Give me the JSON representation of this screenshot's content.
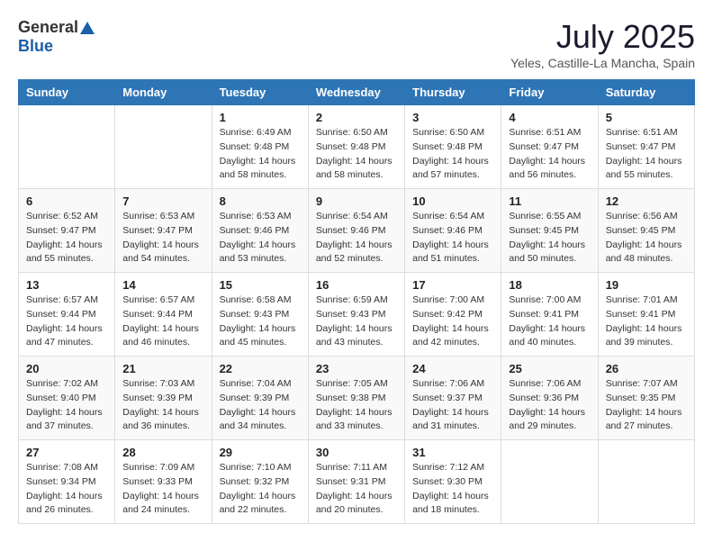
{
  "header": {
    "logo_general": "General",
    "logo_blue": "Blue",
    "month": "July 2025",
    "location": "Yeles, Castille-La Mancha, Spain"
  },
  "days_of_week": [
    "Sunday",
    "Monday",
    "Tuesday",
    "Wednesday",
    "Thursday",
    "Friday",
    "Saturday"
  ],
  "weeks": [
    [
      {
        "day": "",
        "sunrise": "",
        "sunset": "",
        "daylight": ""
      },
      {
        "day": "",
        "sunrise": "",
        "sunset": "",
        "daylight": ""
      },
      {
        "day": "1",
        "sunrise": "Sunrise: 6:49 AM",
        "sunset": "Sunset: 9:48 PM",
        "daylight": "Daylight: 14 hours and 58 minutes."
      },
      {
        "day": "2",
        "sunrise": "Sunrise: 6:50 AM",
        "sunset": "Sunset: 9:48 PM",
        "daylight": "Daylight: 14 hours and 58 minutes."
      },
      {
        "day": "3",
        "sunrise": "Sunrise: 6:50 AM",
        "sunset": "Sunset: 9:48 PM",
        "daylight": "Daylight: 14 hours and 57 minutes."
      },
      {
        "day": "4",
        "sunrise": "Sunrise: 6:51 AM",
        "sunset": "Sunset: 9:47 PM",
        "daylight": "Daylight: 14 hours and 56 minutes."
      },
      {
        "day": "5",
        "sunrise": "Sunrise: 6:51 AM",
        "sunset": "Sunset: 9:47 PM",
        "daylight": "Daylight: 14 hours and 55 minutes."
      }
    ],
    [
      {
        "day": "6",
        "sunrise": "Sunrise: 6:52 AM",
        "sunset": "Sunset: 9:47 PM",
        "daylight": "Daylight: 14 hours and 55 minutes."
      },
      {
        "day": "7",
        "sunrise": "Sunrise: 6:53 AM",
        "sunset": "Sunset: 9:47 PM",
        "daylight": "Daylight: 14 hours and 54 minutes."
      },
      {
        "day": "8",
        "sunrise": "Sunrise: 6:53 AM",
        "sunset": "Sunset: 9:46 PM",
        "daylight": "Daylight: 14 hours and 53 minutes."
      },
      {
        "day": "9",
        "sunrise": "Sunrise: 6:54 AM",
        "sunset": "Sunset: 9:46 PM",
        "daylight": "Daylight: 14 hours and 52 minutes."
      },
      {
        "day": "10",
        "sunrise": "Sunrise: 6:54 AM",
        "sunset": "Sunset: 9:46 PM",
        "daylight": "Daylight: 14 hours and 51 minutes."
      },
      {
        "day": "11",
        "sunrise": "Sunrise: 6:55 AM",
        "sunset": "Sunset: 9:45 PM",
        "daylight": "Daylight: 14 hours and 50 minutes."
      },
      {
        "day": "12",
        "sunrise": "Sunrise: 6:56 AM",
        "sunset": "Sunset: 9:45 PM",
        "daylight": "Daylight: 14 hours and 48 minutes."
      }
    ],
    [
      {
        "day": "13",
        "sunrise": "Sunrise: 6:57 AM",
        "sunset": "Sunset: 9:44 PM",
        "daylight": "Daylight: 14 hours and 47 minutes."
      },
      {
        "day": "14",
        "sunrise": "Sunrise: 6:57 AM",
        "sunset": "Sunset: 9:44 PM",
        "daylight": "Daylight: 14 hours and 46 minutes."
      },
      {
        "day": "15",
        "sunrise": "Sunrise: 6:58 AM",
        "sunset": "Sunset: 9:43 PM",
        "daylight": "Daylight: 14 hours and 45 minutes."
      },
      {
        "day": "16",
        "sunrise": "Sunrise: 6:59 AM",
        "sunset": "Sunset: 9:43 PM",
        "daylight": "Daylight: 14 hours and 43 minutes."
      },
      {
        "day": "17",
        "sunrise": "Sunrise: 7:00 AM",
        "sunset": "Sunset: 9:42 PM",
        "daylight": "Daylight: 14 hours and 42 minutes."
      },
      {
        "day": "18",
        "sunrise": "Sunrise: 7:00 AM",
        "sunset": "Sunset: 9:41 PM",
        "daylight": "Daylight: 14 hours and 40 minutes."
      },
      {
        "day": "19",
        "sunrise": "Sunrise: 7:01 AM",
        "sunset": "Sunset: 9:41 PM",
        "daylight": "Daylight: 14 hours and 39 minutes."
      }
    ],
    [
      {
        "day": "20",
        "sunrise": "Sunrise: 7:02 AM",
        "sunset": "Sunset: 9:40 PM",
        "daylight": "Daylight: 14 hours and 37 minutes."
      },
      {
        "day": "21",
        "sunrise": "Sunrise: 7:03 AM",
        "sunset": "Sunset: 9:39 PM",
        "daylight": "Daylight: 14 hours and 36 minutes."
      },
      {
        "day": "22",
        "sunrise": "Sunrise: 7:04 AM",
        "sunset": "Sunset: 9:39 PM",
        "daylight": "Daylight: 14 hours and 34 minutes."
      },
      {
        "day": "23",
        "sunrise": "Sunrise: 7:05 AM",
        "sunset": "Sunset: 9:38 PM",
        "daylight": "Daylight: 14 hours and 33 minutes."
      },
      {
        "day": "24",
        "sunrise": "Sunrise: 7:06 AM",
        "sunset": "Sunset: 9:37 PM",
        "daylight": "Daylight: 14 hours and 31 minutes."
      },
      {
        "day": "25",
        "sunrise": "Sunrise: 7:06 AM",
        "sunset": "Sunset: 9:36 PM",
        "daylight": "Daylight: 14 hours and 29 minutes."
      },
      {
        "day": "26",
        "sunrise": "Sunrise: 7:07 AM",
        "sunset": "Sunset: 9:35 PM",
        "daylight": "Daylight: 14 hours and 27 minutes."
      }
    ],
    [
      {
        "day": "27",
        "sunrise": "Sunrise: 7:08 AM",
        "sunset": "Sunset: 9:34 PM",
        "daylight": "Daylight: 14 hours and 26 minutes."
      },
      {
        "day": "28",
        "sunrise": "Sunrise: 7:09 AM",
        "sunset": "Sunset: 9:33 PM",
        "daylight": "Daylight: 14 hours and 24 minutes."
      },
      {
        "day": "29",
        "sunrise": "Sunrise: 7:10 AM",
        "sunset": "Sunset: 9:32 PM",
        "daylight": "Daylight: 14 hours and 22 minutes."
      },
      {
        "day": "30",
        "sunrise": "Sunrise: 7:11 AM",
        "sunset": "Sunset: 9:31 PM",
        "daylight": "Daylight: 14 hours and 20 minutes."
      },
      {
        "day": "31",
        "sunrise": "Sunrise: 7:12 AM",
        "sunset": "Sunset: 9:30 PM",
        "daylight": "Daylight: 14 hours and 18 minutes."
      },
      {
        "day": "",
        "sunrise": "",
        "sunset": "",
        "daylight": ""
      },
      {
        "day": "",
        "sunrise": "",
        "sunset": "",
        "daylight": ""
      }
    ]
  ]
}
